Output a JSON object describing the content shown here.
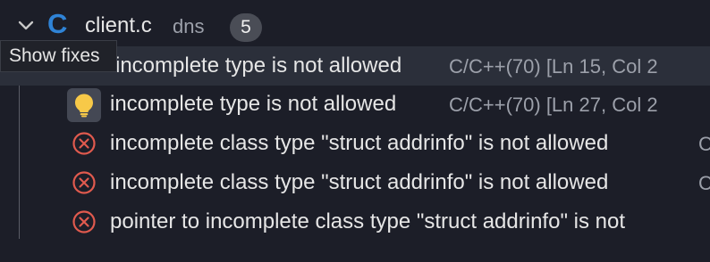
{
  "file_group": {
    "chevron_icon": "chevron-down-icon",
    "language_icon_glyph": "C",
    "file_name": "client.c",
    "folder": "dns",
    "problem_count": "5"
  },
  "tooltip": {
    "text": "Show fixes"
  },
  "problems": [
    {
      "icon": "lightbulb-icon",
      "message": "incomplete type is not allowed",
      "source": "C/C++(70)  [Ln 15, Col 2"
    },
    {
      "icon": "lightbulb-icon",
      "message": "incomplete type is not allowed",
      "source": "C/C++(70)  [Ln 27, Col 2"
    },
    {
      "icon": "error-icon",
      "message": "incomplete class type \"struct addrinfo\" is not allowed",
      "source": "C"
    },
    {
      "icon": "error-icon",
      "message": "incomplete class type \"struct addrinfo\" is not allowed",
      "source": "C"
    },
    {
      "icon": "error-icon",
      "message": "pointer to incomplete class type \"struct addrinfo\" is not",
      "source": ""
    }
  ],
  "colors": {
    "background": "#1c1e28",
    "selected_row": "#2b2f3a",
    "c_language_icon": "#2f83d6",
    "error_icon": "#e05a4e",
    "lightbulb": "#f7c948",
    "badge": "#4a4d56"
  }
}
